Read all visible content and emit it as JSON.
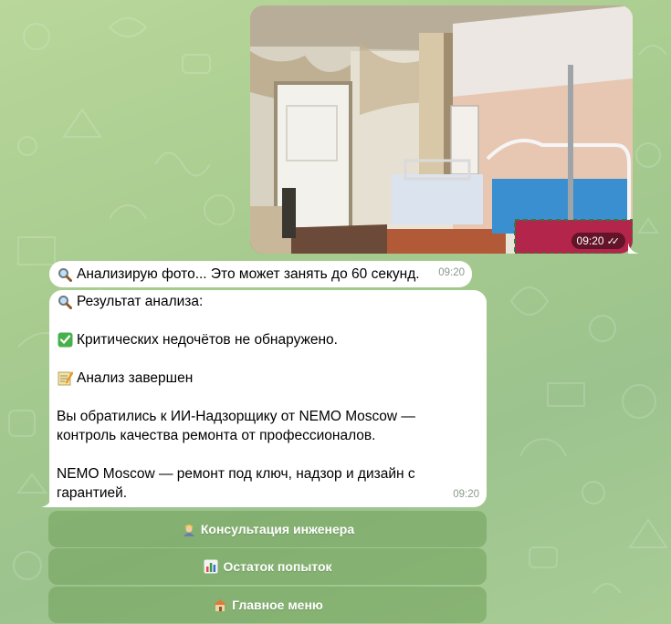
{
  "photo_message": {
    "time": "09:20",
    "status": "read"
  },
  "messages": [
    {
      "text": "Анализирую фото... Это может занять до 60 секунд.",
      "time": "09:20"
    },
    {
      "header": "Результат анализа:",
      "no_issues": "Критических недочётов не обнаружено.",
      "done": "Анализ завершен",
      "intro_line1": "Вы обратились к ИИ-Надзорщику от NEMO Moscow —",
      "intro_line2": "контроль качества ремонта от профессионалов.",
      "outro_line1": "NEMO Moscow — ремонт под ключ, надзор и дизайн с",
      "outro_line2": "гарантией.",
      "time": "09:20"
    }
  ],
  "keyboard": [
    {
      "label": "Консультация инженера",
      "icon": "engineer-icon"
    },
    {
      "label": "Остаток попыток",
      "icon": "bar-chart-icon"
    },
    {
      "label": "Главное меню",
      "icon": "house-icon"
    }
  ],
  "colors": {
    "background": "#a7cb8f",
    "bubble_incoming": "#ffffff",
    "button": "#70a05a"
  }
}
